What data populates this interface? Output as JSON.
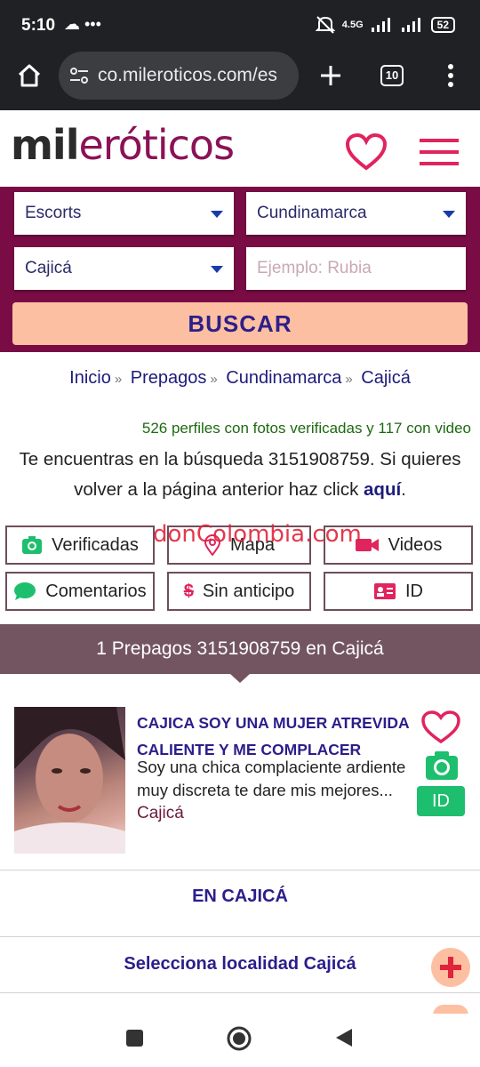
{
  "status": {
    "time": "5:10",
    "battery": "52",
    "network": "4.5G"
  },
  "browser": {
    "url": "co.mileroticos.com/es",
    "tab_count": "10"
  },
  "site": {
    "logo_part1": "mil",
    "logo_part2": "eróticos"
  },
  "search": {
    "category": "Escorts",
    "region": "Cundinamarca",
    "city": "Cajicá",
    "keyword_placeholder": "Ejemplo: Rubia",
    "submit_label": "BUSCAR"
  },
  "breadcrumb": [
    "Inicio",
    "Prepagos",
    "Cundinamarca",
    "Cajicá"
  ],
  "stats_text": "526 perfiles con fotos verificadas y 117 con video",
  "description": {
    "text": "Te encuentras en la búsqueda 3151908759. Si quieres volver a la página anterior haz click ",
    "link": "aquí",
    "end": "."
  },
  "filters": {
    "verificadas": "Verificadas",
    "mapa": "Mapa",
    "videos": "Videos",
    "comentarios": "Comentarios",
    "sin_anticipo": "Sin anticipo",
    "id": "ID"
  },
  "watermark": "donColombia.com",
  "results_banner": "1 Prepagos 3151908759 en Cajicá",
  "listing": {
    "title": "CAJICA SOY UNA MUJER ATREVIDA CALIENTE Y ME COMPLACER",
    "snippet": "Soy una chica complaciente ardiente muy discreta te dare mis mejores...",
    "location": "Cajicá",
    "id_badge": "ID"
  },
  "sections": {
    "en_city": "EN CAJICÁ",
    "locality": "Selecciona localidad Cajicá"
  },
  "colors": {
    "brand": "#7a0c45",
    "accent": "#fdbfa1",
    "link": "#2b1e8a",
    "heart": "#e0245e",
    "verified_green": "#1dbf6e",
    "banner": "#735562"
  }
}
